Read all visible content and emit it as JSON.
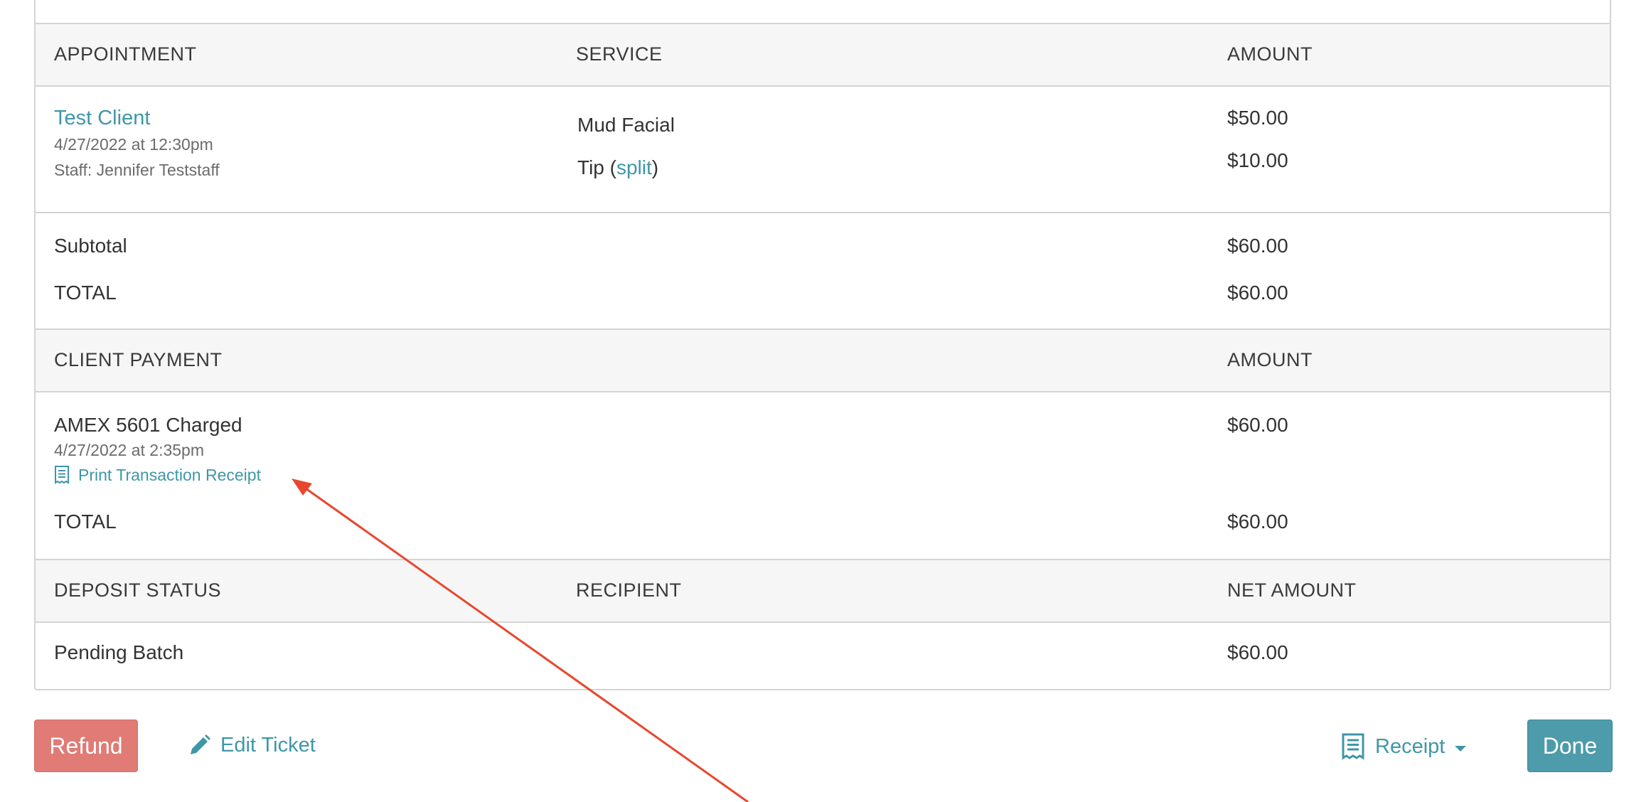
{
  "headers": {
    "appointment": "APPOINTMENT",
    "service": "SERVICE",
    "amount": "AMOUNT",
    "client_payment": "CLIENT PAYMENT",
    "payment_amount": "AMOUNT",
    "deposit_status": "DEPOSIT STATUS",
    "recipient": "RECIPIENT",
    "net_amount": "NET AMOUNT"
  },
  "appointment": {
    "client_name": "Test Client",
    "datetime": "4/27/2022 at 12:30pm",
    "staff": "Staff: Jennifer Teststaff",
    "service": "Mud Facial",
    "service_amount": "$50.00",
    "tip_prefix": "Tip (",
    "tip_link": "split",
    "tip_suffix": ")",
    "tip_amount": "$10.00"
  },
  "totals": {
    "subtotal_label": "Subtotal",
    "subtotal_amount": "$60.00",
    "total_label": "TOTAL",
    "total_amount": "$60.00"
  },
  "payment": {
    "method": "AMEX 5601 Charged",
    "datetime": "4/27/2022 at 2:35pm",
    "print_receipt": "Print Transaction Receipt",
    "amount": "$60.00",
    "total_label": "TOTAL",
    "total_amount": "$60.00"
  },
  "deposit": {
    "status": "Pending Batch",
    "recipient": "",
    "net_amount": "$60.00"
  },
  "actions": {
    "refund": "Refund",
    "edit_ticket": "Edit Ticket",
    "receipt": "Receipt",
    "done": "Done"
  },
  "icons": {
    "receipt_small": "receipt-icon",
    "pencil": "pencil-icon",
    "receipt_large": "receipt-icon",
    "dropdown": "caret-down-icon"
  },
  "colors": {
    "link": "#3e97a8",
    "refund_button": "#e07b75",
    "done_button": "#4d9bab",
    "header_bg": "#f6f6f6",
    "border": "#d4d4d4",
    "annotation_arrow": "#e8472d"
  }
}
